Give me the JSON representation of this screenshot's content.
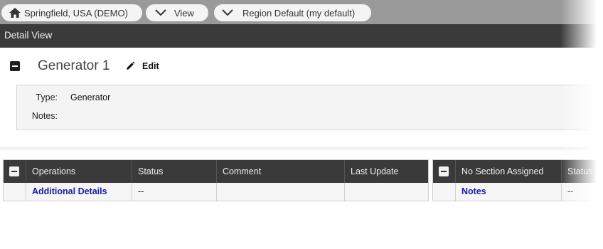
{
  "breadcrumbs": {
    "location": "Springfield, USA (DEMO)",
    "view": "View",
    "region": "Region Default (my default)"
  },
  "title_bar": "Detail View",
  "record": {
    "title": "Generator 1",
    "edit_label": "Edit",
    "fields": [
      {
        "label": "Type:",
        "value": "Generator"
      },
      {
        "label": "Notes:",
        "value": ""
      }
    ]
  },
  "tables": [
    {
      "columns": [
        "Operations",
        "Status",
        "Comment",
        "Last Update"
      ],
      "rows": [
        [
          "Additional Details",
          "--",
          "",
          ""
        ]
      ]
    },
    {
      "columns": [
        "No Section Assigned",
        "Status"
      ],
      "rows": [
        [
          "Notes",
          "--"
        ]
      ]
    }
  ],
  "icons": {
    "home": "home-icon",
    "chevron": "chevron-down-icon",
    "edit": "pencil-icon",
    "collapse": "collapse-icon"
  }
}
